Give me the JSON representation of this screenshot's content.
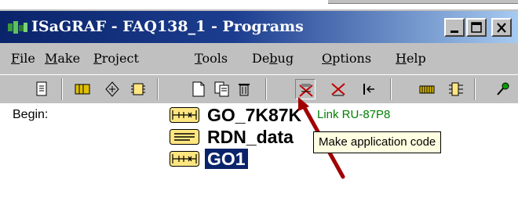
{
  "window": {
    "title": "ISaGRAF - FAQ138_1 - Programs",
    "controls": {
      "minimize": "minimize",
      "maximize": "maximize",
      "close": "close"
    }
  },
  "menu": {
    "items": [
      {
        "label": "File",
        "hotkey": "F",
        "rest": "ile"
      },
      {
        "label": "Make",
        "hotkey": "M",
        "rest": "ake"
      },
      {
        "label": "Project",
        "hotkey": "P",
        "rest": "roject"
      },
      {
        "label": "Tools",
        "hotkey": "T",
        "rest": "ools"
      },
      {
        "label": "Debug",
        "pre": "De",
        "hotkey": "b",
        "rest": "ug"
      },
      {
        "label": "Options",
        "hotkey": "O",
        "rest": "ptions"
      },
      {
        "label": "Help",
        "hotkey": "H",
        "rest": "elp"
      }
    ]
  },
  "toolbar": {
    "buttons": [
      "document-icon",
      "dictionary-icon",
      "io-connection-icon",
      "variables-icon",
      "new-icon",
      "copy-icon",
      "delete-icon",
      "make-code-icon",
      "verify-icon",
      "link-icon",
      "io-board-icon",
      "simulate-icon",
      "debug-icon"
    ]
  },
  "content": {
    "section_label": "Begin:",
    "programs": [
      {
        "name": "GO_7K87K",
        "comment": "Link RU-87P8",
        "type": "ld"
      },
      {
        "name": "RDN_data",
        "comment": "",
        "type": "st"
      },
      {
        "name": "GO1",
        "comment": "",
        "type": "ld",
        "selected": true
      }
    ]
  },
  "tooltip": {
    "text": "Make application code"
  },
  "colors": {
    "title_bar_start": "#0a246a",
    "title_bar_end": "#a6caf0",
    "comment": "#008000",
    "selection": "#0a246a",
    "tooltip_bg": "#ffffe1",
    "arrow": "#a00000"
  }
}
